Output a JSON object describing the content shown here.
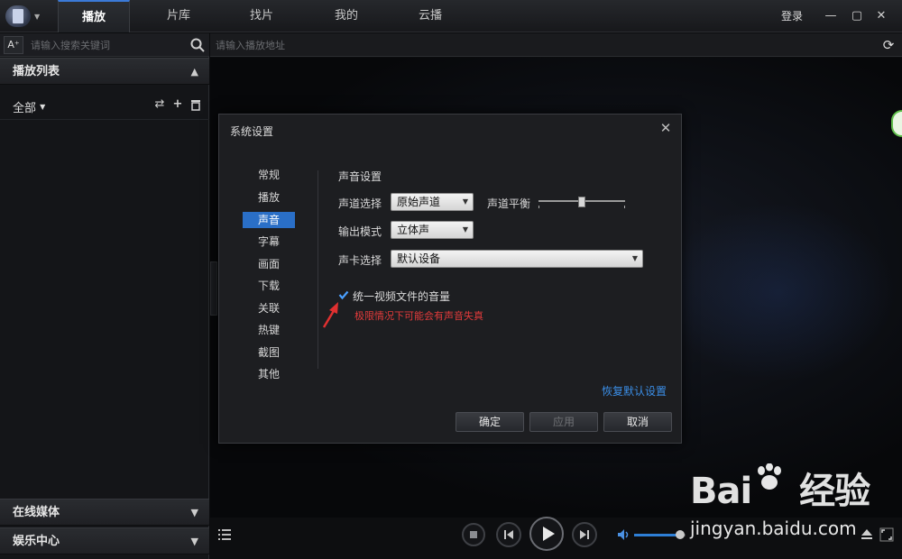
{
  "topbar": {
    "tabs": [
      {
        "label": "播放",
        "active": true
      },
      {
        "label": "片库",
        "active": false
      },
      {
        "label": "找片",
        "active": false
      },
      {
        "label": "我的",
        "active": false
      },
      {
        "label": "云播",
        "active": false
      }
    ],
    "login_label": "登录",
    "icons": {
      "minimize": "minimize-icon",
      "maximize": "maximize-icon",
      "close": "close-icon"
    }
  },
  "sidebar": {
    "font_button": "A⁺",
    "search_placeholder": "请输入搜索关键词",
    "playlist_title": "播放列表",
    "filter_label": "全部",
    "online_media_title": "在线媒体",
    "entertainment_title": "娱乐中心"
  },
  "main": {
    "address_placeholder": "请输入播放地址"
  },
  "dialog": {
    "title": "系统设置",
    "nav": [
      {
        "label": "常规",
        "active": false
      },
      {
        "label": "播放",
        "active": false
      },
      {
        "label": "声音",
        "active": true
      },
      {
        "label": "字幕",
        "active": false
      },
      {
        "label": "画面",
        "active": false
      },
      {
        "label": "下载",
        "active": false
      },
      {
        "label": "关联",
        "active": false
      },
      {
        "label": "热键",
        "active": false
      },
      {
        "label": "截图",
        "active": false
      },
      {
        "label": "其他",
        "active": false
      }
    ],
    "section_title": "声音设置",
    "channel_label": "声道选择",
    "channel_value": "原始声道",
    "balance_label": "声道平衡",
    "balance_position": 0.5,
    "output_label": "输出模式",
    "output_value": "立体声",
    "soundcard_label": "声卡选择",
    "soundcard_value": "默认设备",
    "normalize_label": "统一视频文件的音量",
    "normalize_checked": true,
    "warning": "极限情况下可能会有声音失真",
    "restore_label": "恢复默认设置",
    "ok_label": "确定",
    "apply_label": "应用",
    "cancel_label": "取消"
  },
  "player": {
    "volume": 0.9
  },
  "watermark": {
    "logo": "Bai 经验",
    "url": "jingyan.baidu.com"
  },
  "colors": {
    "accent": "#2a6fc7",
    "link": "#3b8ee6",
    "warning": "#e23b3b"
  }
}
